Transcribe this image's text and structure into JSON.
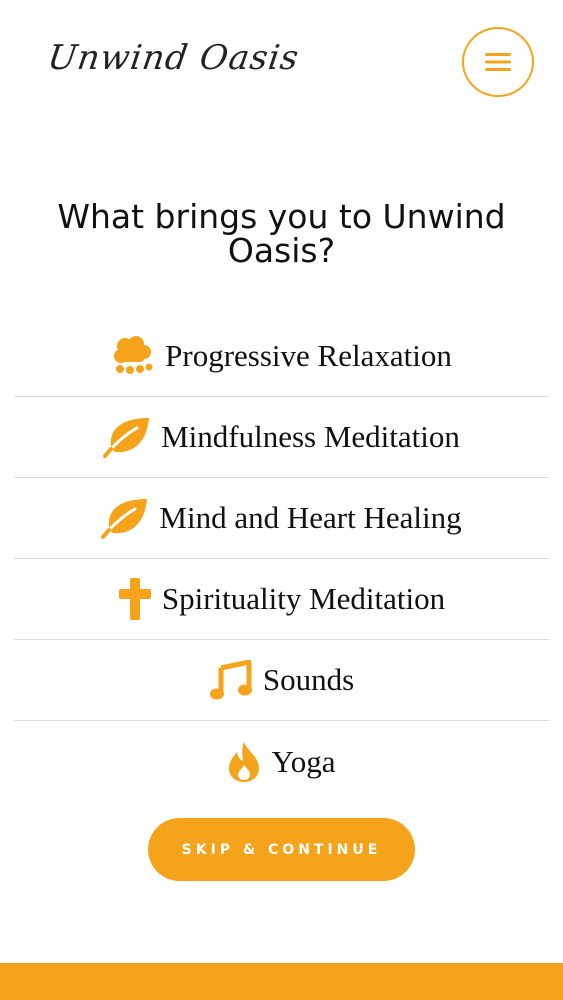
{
  "header": {
    "logo_text": "Unwind Oasis",
    "menu_icon": "hamburger-menu-icon"
  },
  "question": "What brings you to Unwind Oasis?",
  "options": [
    {
      "label": "Progressive Relaxation",
      "icon": "brain-icon"
    },
    {
      "label": "Mindfulness Meditation",
      "icon": "leaf-icon"
    },
    {
      "label": "Mind and Heart Healing",
      "icon": "leaf-icon"
    },
    {
      "label": "Spirituality Meditation",
      "icon": "cross-icon"
    },
    {
      "label": "Sounds",
      "icon": "music-note-icon"
    },
    {
      "label": "Yoga",
      "icon": "flame-icon"
    }
  ],
  "cta_label": "SKIP & CONTINUE",
  "colors": {
    "accent": "#f5a31a",
    "text": "#111111",
    "divider": "#dcdcdc"
  }
}
